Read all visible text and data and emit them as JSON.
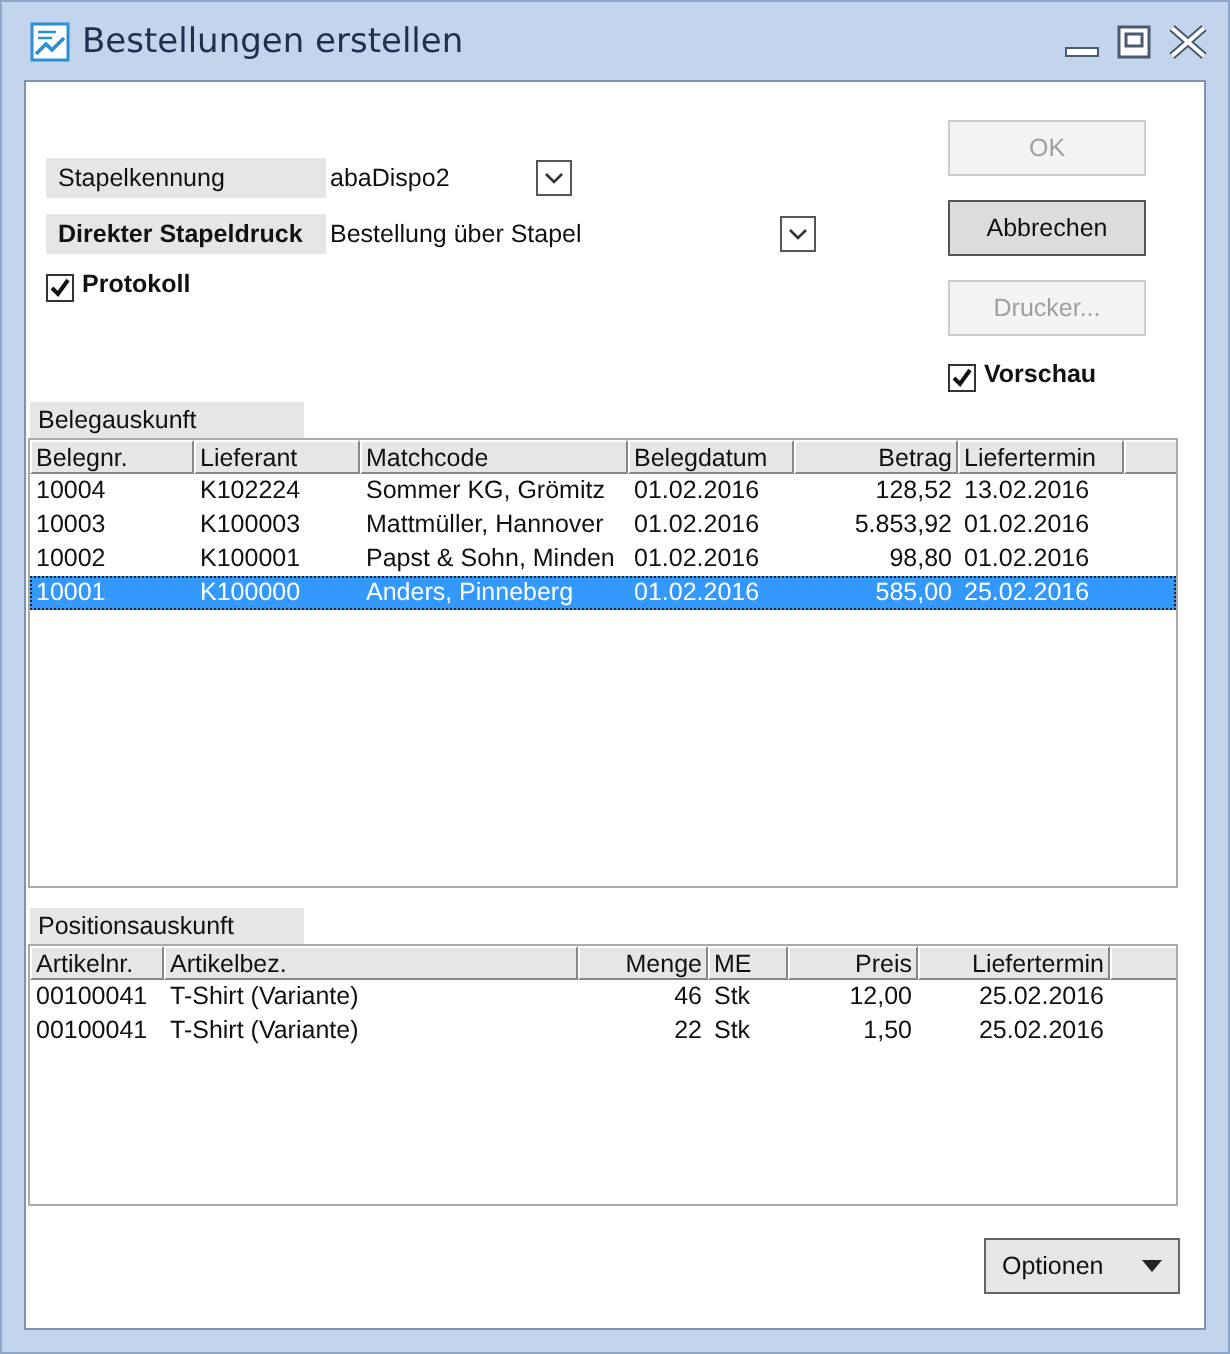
{
  "window": {
    "title": "Bestellungen erstellen"
  },
  "form": {
    "fields": [
      {
        "label": "Stapelkennung",
        "value": "abaDispo2",
        "bold": false
      },
      {
        "label": "Direkter Stapeldruck",
        "value": "Bestellung über Stapel",
        "bold": true
      }
    ],
    "protokoll": {
      "label": "Protokoll",
      "checked": true
    }
  },
  "buttons": [
    {
      "label": "OK",
      "disabled": true
    },
    {
      "label": "Abbrechen",
      "disabled": false
    },
    {
      "label": "Drucker...",
      "disabled": true
    }
  ],
  "vorschau": {
    "label": "Vorschau",
    "checked": true
  },
  "belegauskunft": {
    "title": "Belegauskunft",
    "columns": [
      "Belegnr.",
      "Lieferant",
      "Matchcode",
      "Belegdatum",
      "Betrag",
      "Liefertermin"
    ],
    "rows": [
      {
        "cells": [
          "10004",
          "K102224",
          "Sommer KG, Grömitz",
          "01.02.2016",
          "128,52",
          "13.02.2016"
        ],
        "selected": false
      },
      {
        "cells": [
          "10003",
          "K100003",
          "Mattmüller, Hannover",
          "01.02.2016",
          "5.853,92",
          "01.02.2016"
        ],
        "selected": false
      },
      {
        "cells": [
          "10002",
          "K100001",
          "Papst & Sohn, Minden",
          "01.02.2016",
          "98,80",
          "01.02.2016"
        ],
        "selected": false
      },
      {
        "cells": [
          "10001",
          "K100000",
          "Anders, Pinneberg",
          "01.02.2016",
          "585,00",
          "25.02.2016"
        ],
        "selected": true
      }
    ]
  },
  "positionsauskunft": {
    "title": "Positionsauskunft",
    "columns": [
      "Artikelnr.",
      "Artikelbez.",
      "Menge",
      "ME",
      "Preis",
      "Liefertermin"
    ],
    "rows": [
      {
        "cells": [
          "00100041",
          "T-Shirt (Variante)",
          "46",
          "Stk",
          "12,00",
          "25.02.2016"
        ],
        "selected": false
      },
      {
        "cells": [
          "00100041",
          "T-Shirt (Variante)",
          "22",
          "Stk",
          "1,50",
          "25.02.2016"
        ],
        "selected": false
      }
    ]
  },
  "options_button": {
    "label": "Optionen"
  }
}
